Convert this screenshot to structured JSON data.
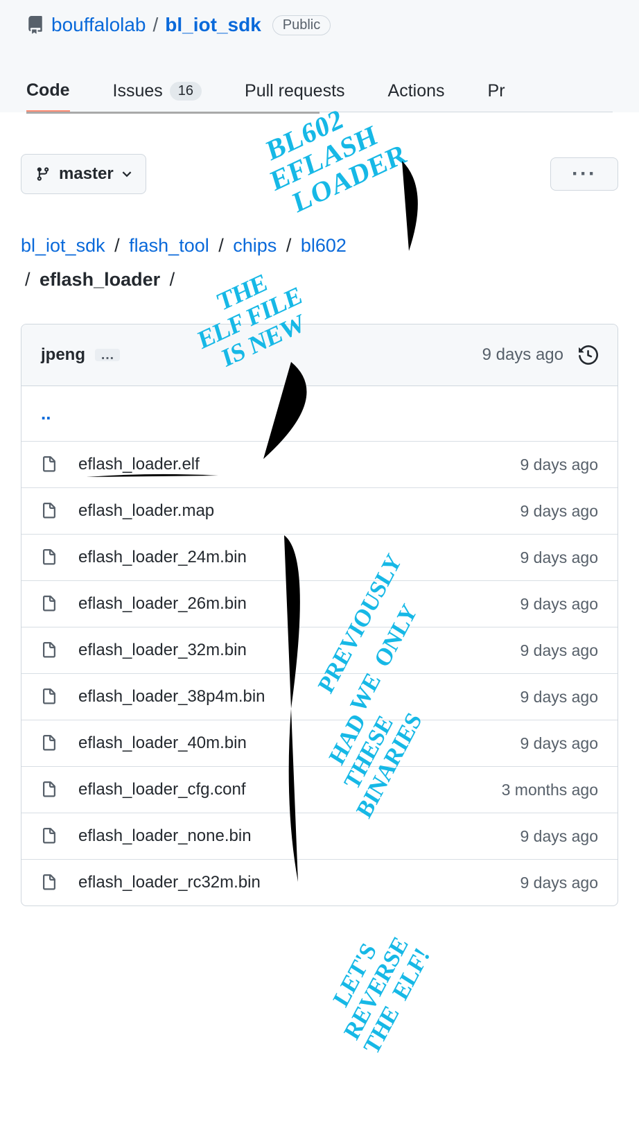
{
  "header": {
    "owner": "bouffalolab",
    "repo": "bl_iot_sdk",
    "visibility": "Public"
  },
  "tabs": {
    "code": "Code",
    "issues": "Issues",
    "issues_count": "16",
    "pulls": "Pull requests",
    "actions": "Actions",
    "projects_partial": "Pr"
  },
  "branch": {
    "name": "master"
  },
  "more_button": "···",
  "path": {
    "parts": [
      "bl_iot_sdk",
      "flash_tool",
      "chips",
      "bl602"
    ],
    "current": "eflash_loader",
    "sep": "/"
  },
  "last_commit": {
    "author": "jpeng",
    "ellipsis": "…",
    "date": "9 days ago"
  },
  "parent_dir": "..",
  "files": [
    {
      "name": "eflash_loader.elf",
      "date": "9 days ago"
    },
    {
      "name": "eflash_loader.map",
      "date": "9 days ago"
    },
    {
      "name": "eflash_loader_24m.bin",
      "date": "9 days ago"
    },
    {
      "name": "eflash_loader_26m.bin",
      "date": "9 days ago"
    },
    {
      "name": "eflash_loader_32m.bin",
      "date": "9 days ago"
    },
    {
      "name": "eflash_loader_38p4m.bin",
      "date": "9 days ago"
    },
    {
      "name": "eflash_loader_40m.bin",
      "date": "9 days ago"
    },
    {
      "name": "eflash_loader_cfg.conf",
      "date": "3 months ago"
    },
    {
      "name": "eflash_loader_none.bin",
      "date": "9 days ago"
    },
    {
      "name": "eflash_loader_rc32m.bin",
      "date": "9 days ago"
    }
  ],
  "annotations": {
    "a1": "BL602\nEFLASH\nLOADER",
    "a2": "THE\nELF FILE\nIS NEW",
    "a3": "PREVIOUSLY\nWE ONLY\nHAD\nTHESE\nBINARIES",
    "a4": "LET'S\nREVERSE\nTHE\nELF!"
  }
}
